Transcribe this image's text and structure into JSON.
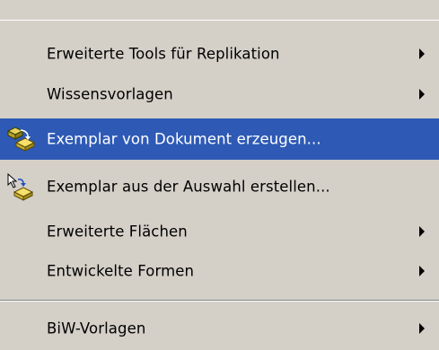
{
  "menu": {
    "items": [
      {
        "label": "Erweiterte Tools für Replikation",
        "has_submenu": true
      },
      {
        "label": "Wissensvorlagen",
        "has_submenu": true
      },
      {
        "label": "Exemplar von Dokument erzeugen...",
        "has_submenu": false,
        "highlighted": true,
        "icon": "instantiate-from-document-icon"
      },
      {
        "label": "Exemplar aus der Auswahl erstellen...",
        "has_submenu": false,
        "icon": "instantiate-from-selection-icon"
      },
      {
        "label": "Erweiterte Flächen",
        "has_submenu": true
      },
      {
        "label": "Entwickelte Formen",
        "has_submenu": true
      },
      {
        "label": "BiW-Vorlagen",
        "has_submenu": true
      }
    ]
  },
  "colors": {
    "menu_background": "#d4d0c8",
    "highlight": "#2e5ab5",
    "highlight_text": "#ffffff",
    "text": "#000000"
  }
}
